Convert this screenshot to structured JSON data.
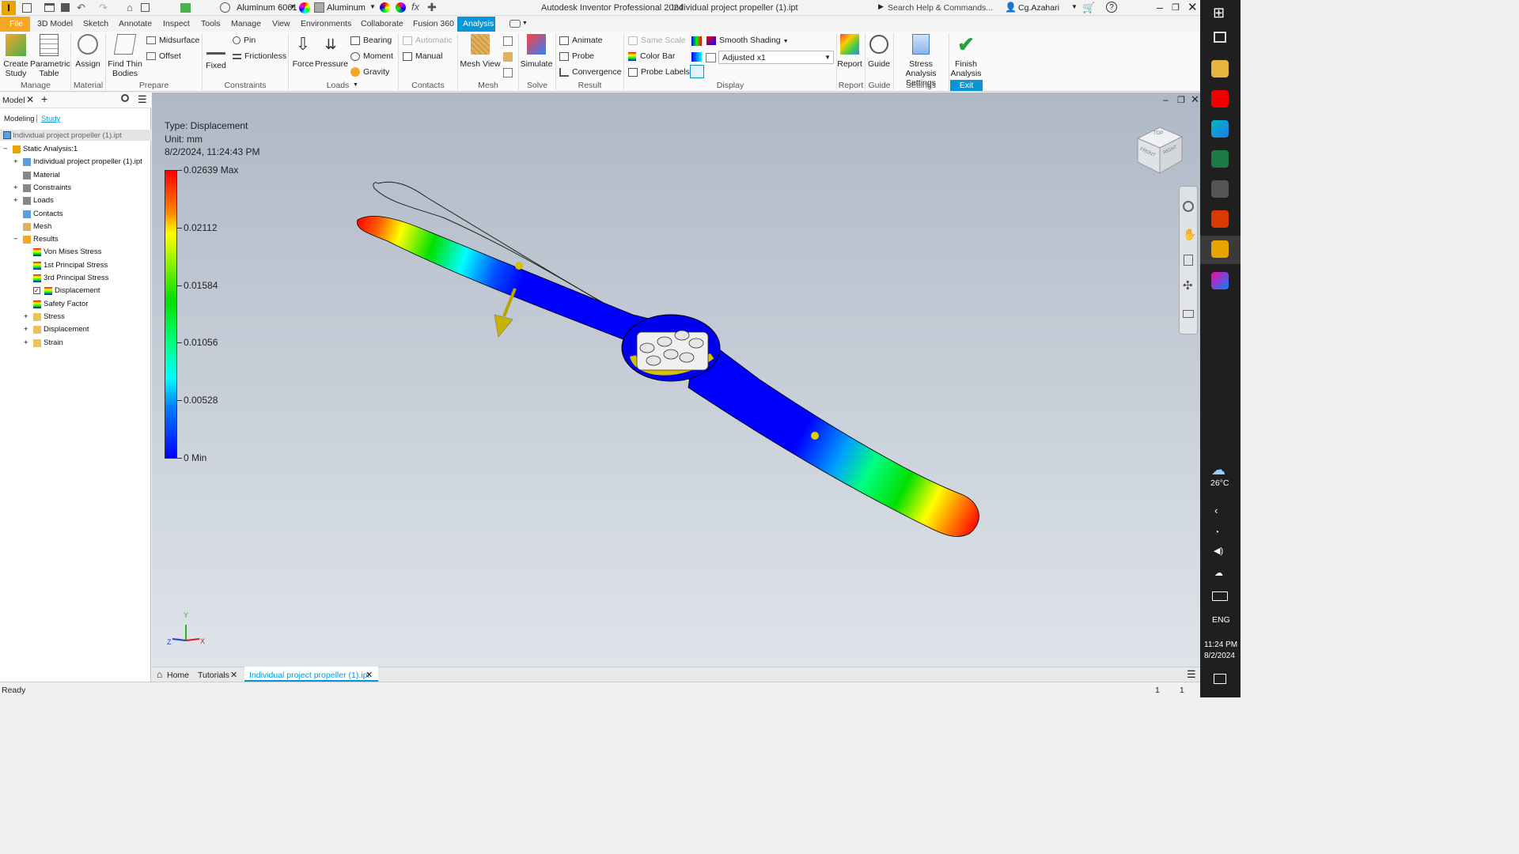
{
  "window": {
    "title": "Autodesk Inventor Professional 2024",
    "document": "Individual project propeller (1).ipt",
    "search_placeholder": "Search Help & Commands...",
    "user": "Cg.Azahari",
    "material": "Aluminum 6061",
    "appearance": "Aluminum"
  },
  "tabs": [
    "File",
    "3D Model",
    "Sketch",
    "Annotate",
    "Inspect",
    "Tools",
    "Manage",
    "View",
    "Environments",
    "Collaborate",
    "Fusion 360",
    "Analysis"
  ],
  "ribbon": {
    "create_study": "Create Study",
    "parametric_table": "Parametric Table",
    "assign": "Assign",
    "find_thin_bodies": "Find Thin Bodies",
    "midsurface": "Midsurface",
    "offset": "Offset",
    "fixed": "Fixed",
    "pin": "Pin",
    "frictionless": "Frictionless",
    "force": "Force",
    "pressure": "Pressure",
    "bearing": "Bearing",
    "moment": "Moment",
    "gravity": "Gravity",
    "automatic": "Automatic",
    "manual": "Manual",
    "mesh_view": "Mesh View",
    "simulate": "Simulate",
    "animate": "Animate",
    "probe": "Probe",
    "convergence": "Convergence",
    "same_scale": "Same Scale",
    "color_bar": "Color Bar",
    "probe_labels": "Probe Labels",
    "smooth_shading": "Smooth Shading",
    "adjusted": "Adjusted x1",
    "report": "Report",
    "guide": "Guide",
    "stress_settings": "Stress Analysis Settings",
    "finish_analysis": "Finish Analysis",
    "groups": [
      "Manage",
      "Material",
      "Prepare",
      "Constraints",
      "Loads",
      "Contacts",
      "Mesh",
      "Solve",
      "Result",
      "Display",
      "Report",
      "Guide",
      "Settings",
      "Exit"
    ]
  },
  "browser": {
    "tab_model": "Model",
    "modeling": "Modeling",
    "study": "Study",
    "root": "Individual project propeller (1).ipt",
    "items": [
      {
        "label": "Static Analysis:1",
        "indent": 0
      },
      {
        "label": "Individual project propeller (1).ipt",
        "indent": 1
      },
      {
        "label": "Material",
        "indent": 1
      },
      {
        "label": "Constraints",
        "indent": 1
      },
      {
        "label": "Loads",
        "indent": 1
      },
      {
        "label": "Contacts",
        "indent": 1
      },
      {
        "label": "Mesh",
        "indent": 1
      },
      {
        "label": "Results",
        "indent": 1
      },
      {
        "label": "Von Mises Stress",
        "indent": 2
      },
      {
        "label": "1st Principal Stress",
        "indent": 2
      },
      {
        "label": "3rd Principal Stress",
        "indent": 2
      },
      {
        "label": "Displacement",
        "indent": 2
      },
      {
        "label": "Safety Factor",
        "indent": 2
      },
      {
        "label": "Stress",
        "indent": 2
      },
      {
        "label": "Displacement",
        "indent": 2
      },
      {
        "label": "Strain",
        "indent": 2
      }
    ]
  },
  "legend": {
    "type": "Type: Displacement",
    "unit": "Unit: mm",
    "date": "8/2/2024, 11:24:43 PM",
    "ticks": [
      "0.02639 Max",
      "0.02112",
      "0.01584",
      "0.01056",
      "0.00528",
      "0 Min"
    ]
  },
  "viewcube": {
    "top": "TOP",
    "front": "FRONT",
    "right": "RIGHT"
  },
  "doc_tabs": [
    "Home",
    "Tutorials",
    "Individual project propeller (1).ipt"
  ],
  "status": {
    "text": "Ready",
    "n1": "1",
    "n2": "1"
  },
  "taskbar": {
    "temp": "26°C",
    "lang": "ENG",
    "time": "11:24 PM",
    "date": "8/2/2024"
  },
  "colors": {
    "accent": "#0696d7",
    "file_tab": "#f5a623",
    "max": "#ff0000",
    "min": "#0000ff"
  }
}
